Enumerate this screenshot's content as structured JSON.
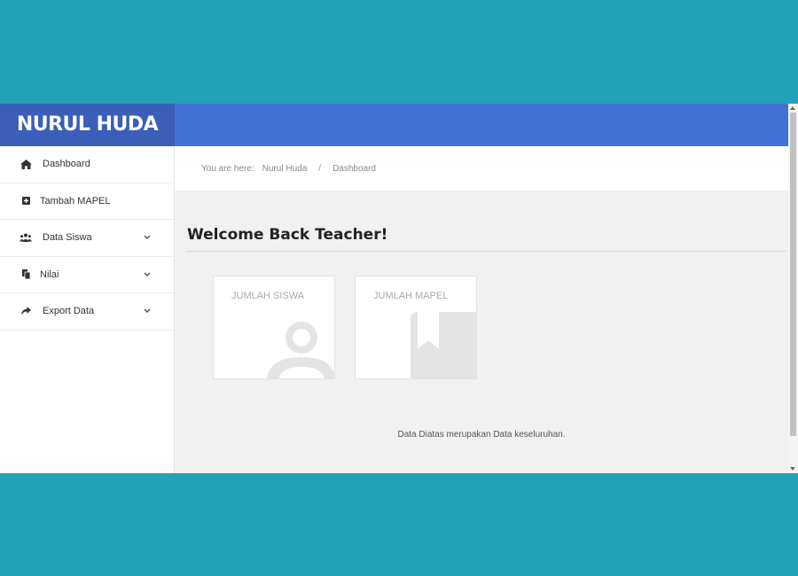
{
  "app": {
    "brand": "NURUL HUDA",
    "accent_color": "#4170d6",
    "brand_color": "#3b5fb8"
  },
  "sidebar": {
    "items": [
      {
        "label": "Dashboard",
        "icon": "home-icon",
        "has_submenu": false
      },
      {
        "label": "Tambah MAPEL",
        "icon": "plus-square-icon",
        "has_submenu": false
      },
      {
        "label": "Data Siswa",
        "icon": "users-icon",
        "has_submenu": true
      },
      {
        "label": "Nilai",
        "icon": "copy-icon",
        "has_submenu": true
      },
      {
        "label": "Export Data",
        "icon": "share-icon",
        "has_submenu": true
      }
    ]
  },
  "breadcrumb": {
    "prefix": "You are here:",
    "items": [
      "Nurul Huda",
      "Dashboard"
    ],
    "separator": "/"
  },
  "main": {
    "title": "Welcome Back Teacher!",
    "cards": [
      {
        "label": "JUMLAH SISWA",
        "icon": "user-icon"
      },
      {
        "label": "JUMLAH MAPEL",
        "icon": "book-icon"
      }
    ],
    "footnote": "Data Diatas merupakan Data keseluruhan."
  }
}
